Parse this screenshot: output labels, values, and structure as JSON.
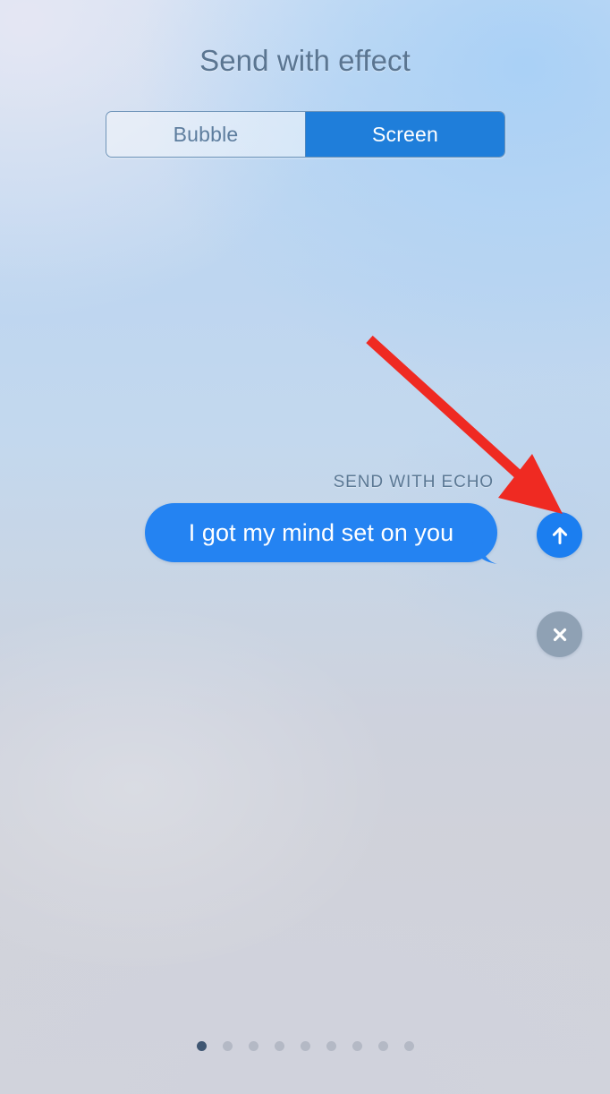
{
  "screen": {
    "title": "Send with effect",
    "background_top": "#c2d9f1",
    "background_bottom": "#d1d3db"
  },
  "segmented_control": {
    "options": [
      {
        "label": "Bubble",
        "selected": false
      },
      {
        "label": "Screen",
        "selected": true
      }
    ],
    "active_color": "#1f7eda",
    "inactive_text_color": "#5d7d9e",
    "border_color": "#6d93b8"
  },
  "effect": {
    "label": "SEND WITH ECHO",
    "label_color": "#5b7894"
  },
  "message": {
    "text": "I got my mind set on you",
    "bubble_color": "#2483f2",
    "text_color": "#ffffff"
  },
  "actions": {
    "send": {
      "icon": "arrow-up-icon",
      "color": "#1b7ef0"
    },
    "close": {
      "icon": "close-x-icon",
      "color": "#8fa1b4"
    }
  },
  "annotation": {
    "arrow_color": "#ef2a22",
    "points_to": "send-button"
  },
  "page_indicator": {
    "total": 9,
    "active_index": 0,
    "active_color": "#3f5672",
    "inactive_color": "#b4b9c5"
  }
}
